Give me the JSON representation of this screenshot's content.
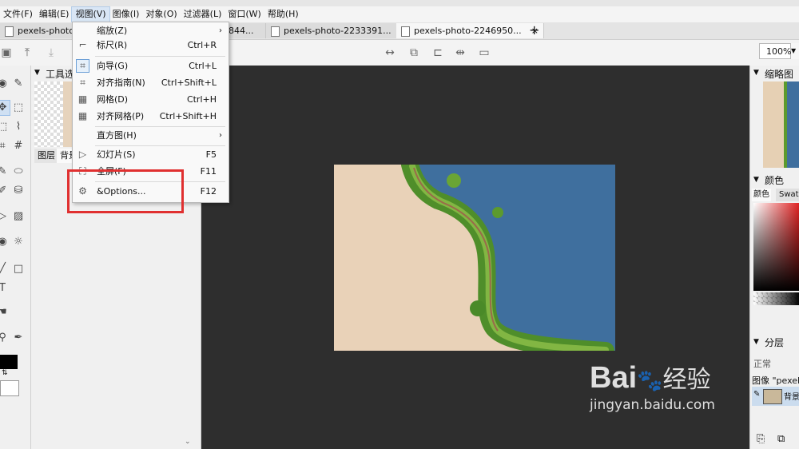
{
  "menubar": {
    "items": [
      "文件(F)",
      "编辑(E)",
      "视图(V)",
      "图像(I)",
      "对象(O)",
      "过滤器(L)",
      "窗口(W)",
      "帮助(H)"
    ]
  },
  "tabs": [
    {
      "label": "pexels-photo"
    },
    {
      "label": "844..."
    },
    {
      "label": "pexels-photo-2233391..."
    },
    {
      "label": "pexels-photo-2246950...",
      "close": "×"
    }
  ],
  "toolbar": {
    "zoom": "100%"
  },
  "view_menu": {
    "items": [
      {
        "label": "缩放(Z)",
        "shortcut": "",
        "submenu": true,
        "icon": "none"
      },
      {
        "label": "标尺(R)",
        "shortcut": "Ctrl+R",
        "submenu": false,
        "icon": "ruler-icon"
      },
      {
        "label": "向导(G)",
        "shortcut": "Ctrl+L",
        "submenu": false,
        "icon": "guide-icon"
      },
      {
        "label": "对齐指南(N)",
        "shortcut": "Ctrl+Shift+L",
        "submenu": false,
        "icon": "snap-guide-icon"
      },
      {
        "label": "网格(D)",
        "shortcut": "Ctrl+H",
        "submenu": false,
        "icon": "grid-icon"
      },
      {
        "label": "对齐网格(P)",
        "shortcut": "Ctrl+Shift+H",
        "submenu": false,
        "icon": "snap-grid-icon"
      },
      {
        "label": "直方图(H)",
        "shortcut": "",
        "submenu": true,
        "icon": "none"
      },
      {
        "label": "幻灯片(S)",
        "shortcut": "F5",
        "submenu": false,
        "icon": "slideshow-icon"
      },
      {
        "label": "全屏(F)",
        "shortcut": "F11",
        "submenu": false,
        "icon": "fullscreen-icon"
      },
      {
        "label": "&Options...",
        "shortcut": "F12",
        "submenu": false,
        "icon": "gear-icon"
      }
    ]
  },
  "left_panel": {
    "title": "工具选",
    "tabs": [
      "图层",
      "背景"
    ]
  },
  "right_panel": {
    "thumbnail_title": "缩略图",
    "color_title": "颜色",
    "color_tabs": [
      "颜色",
      "Swat"
    ],
    "layers_title": "分层",
    "blend_mode": "正常",
    "image_label": "图像 \"pexels",
    "layer_name": "背景"
  },
  "watermark": {
    "brand": "Bai",
    "brand_cn": "经验",
    "url": "jingyan.baidu.com"
  },
  "colors": {
    "canvas_bg": "#2e2e2e",
    "menu_highlight": "#d9e6f5",
    "red_box": "#e03030",
    "water": "#3f6f9e",
    "sand": "#e8d0b4",
    "foliage": "#5c9a2e"
  }
}
